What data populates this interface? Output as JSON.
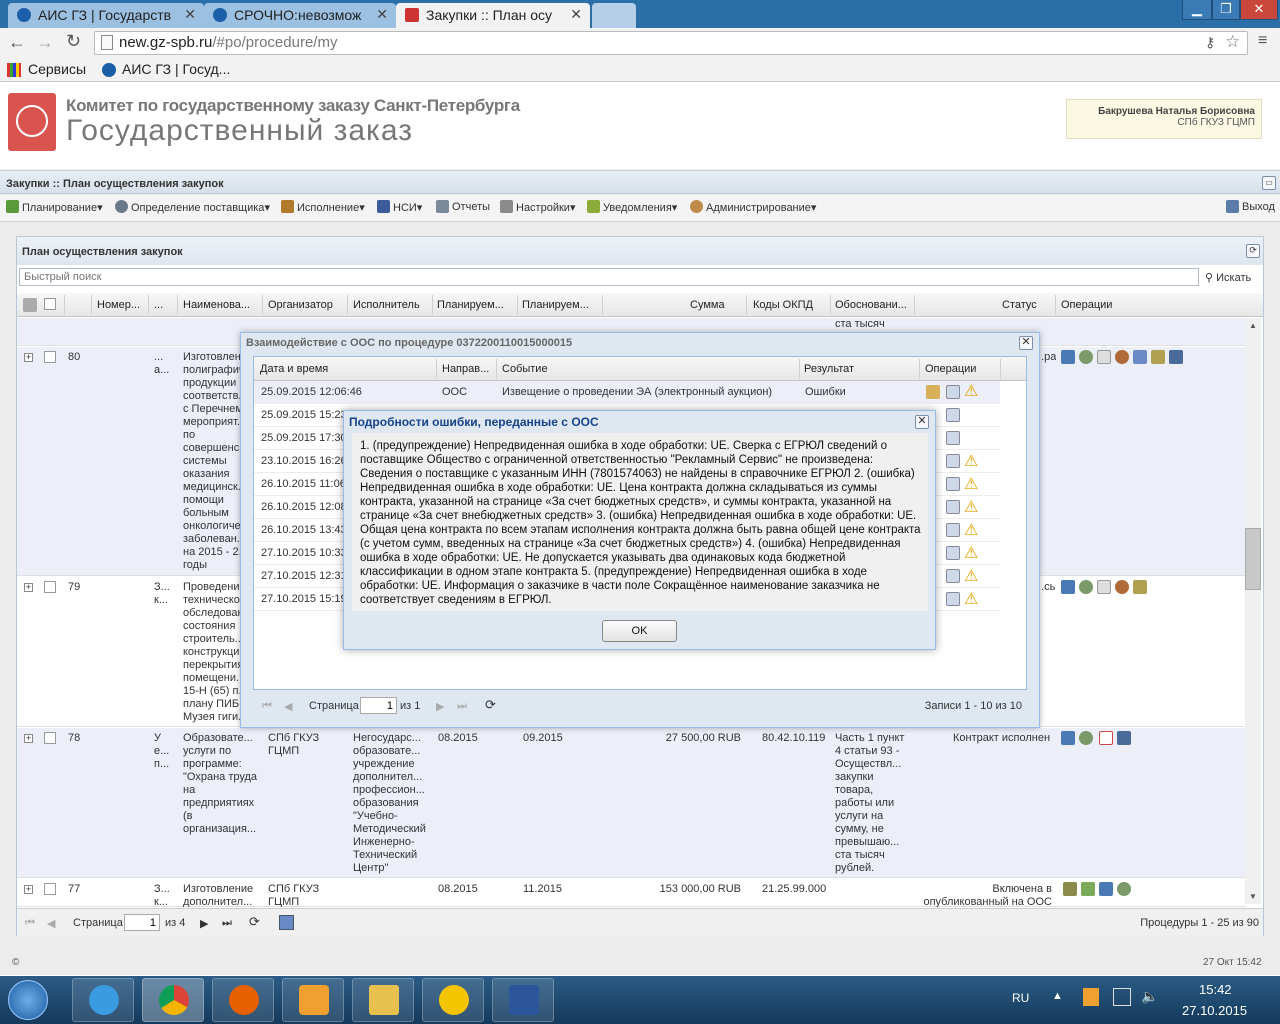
{
  "browser": {
    "tabs": [
      {
        "label": "АИС ГЗ | Государств",
        "active": false
      },
      {
        "label": "СРОЧНО:невозмож",
        "active": false
      },
      {
        "label": "Закупки :: План осу",
        "active": true
      }
    ],
    "url_host": "new.gz-spb.ru",
    "url_path": "/#po/procedure/my",
    "bookmarks": [
      {
        "label": "Сервисы"
      },
      {
        "label": "АИС ГЗ | Госуд..."
      }
    ]
  },
  "header": {
    "org_line1": "Комитет по государственному заказу Санкт-Петербурга",
    "org_line2": "Государственный заказ",
    "user_name": "Бакрушева Наталья Борисовна",
    "user_org": "СПб ГКУЗ ГЦМП"
  },
  "main_panel_title": "Закупки :: План осуществления закупок",
  "menu": {
    "items": [
      {
        "label": "Планирование",
        "color": "#5b9a3a"
      },
      {
        "label": "Определение поставщика",
        "color": "#6a7a8a"
      },
      {
        "label": "Исполнение",
        "color": "#b07a2a"
      },
      {
        "label": "НСИ",
        "color": "#3b5b9a"
      },
      {
        "label": "Отчеты",
        "color": "#7a8a9a"
      },
      {
        "label": "Настройки",
        "color": "#8a8a8a"
      },
      {
        "label": "Уведомления",
        "color": "#8aaa3a"
      },
      {
        "label": "Администрирование",
        "color": "#c08a4a"
      }
    ],
    "logout": "Выход"
  },
  "grid": {
    "title": "План осуществления закупок",
    "search_placeholder": "Быстрый поиск",
    "search_button": "Искать",
    "columns": [
      "Номер...",
      "...",
      "Наименова...",
      "Организатор",
      "Исполнитель",
      "Планируем...",
      "Планируем...",
      "Сумма",
      "Коды ОКПД",
      "Обосновани...",
      "Статус",
      "Операции"
    ],
    "top_fragment": "ста тысяч",
    "rows": [
      {
        "num": "80",
        "c2": "...\nа...",
        "name": "Изготовлен...\nполиграфич...\nпродукции\nсоответств...\nс Перечнем\nмероприят...\nпо\nсовершенс...\nсистемы\nоказания\nмедицинск...\nпомощи\nбольным\nонкологиче...\nзаболеван...\nна 2015 - 2...\nгоды",
        "org": "",
        "exec": "",
        "plan1": "",
        "plan2": "",
        "sum": "",
        "okpd": "",
        "basis": "",
        "status": "...ра"
      },
      {
        "num": "79",
        "c2": "З...\nк...",
        "name": "Проведени...\nтехническо...\nобследован...\nсостояния\nстроитель...\nконструкци...\nперекрытия\nпомещени...\n15-Н (65) п...\nплану ПИБ\nМузея гиги...",
        "org": "",
        "exec": "",
        "plan1": "",
        "plan2": "",
        "sum": "",
        "okpd": "",
        "basis": "",
        "status": "...сь"
      },
      {
        "num": "78",
        "c2": "У\nе...\nп...",
        "name": "Образовате...\nуслуги по\nпрограмме:\n\"Охрана труда\nна\nпредприятиях\n(в\nорганизация...",
        "org": "СПб ГКУЗ\nГЦМП",
        "exec": "Негосударс...\nобразовате...\nучреждение\nдополнител...\nпрофессион...\nобразования\n\"Учебно-\nМетодический\nИнженерно-\nТехнический\nЦентр\"",
        "plan1": "08.2015",
        "plan2": "09.2015",
        "sum": "27 500,00 RUB",
        "okpd": "80.42.10.119",
        "basis": "Часть 1 пункт\n4 статьи 93 -\nОсуществл...\nзакупки\nтовара,\nработы или\nуслуги на\nсумму, не\nпревышаю...\nста тысяч\nрублей.",
        "status": "Контракт исполнен"
      },
      {
        "num": "77",
        "c2": "З...\nк...",
        "name": "Изготовление\nдополнител...",
        "org": "СПб ГКУЗ\nГЦМП",
        "exec": "",
        "plan1": "08.2015",
        "plan2": "11.2015",
        "sum": "153 000,00 RUB",
        "okpd": "21.25.99.000",
        "basis": "",
        "status": "Включена в\nопубликованный на ООС"
      }
    ],
    "pager": {
      "page_label": "Страница",
      "page": "1",
      "of": "из 4",
      "summary": "Процедуры 1 - 25 из 90"
    }
  },
  "dialog_ooc": {
    "title": "Взаимодействие с ООС по процедуре 0372200110015000015",
    "columns": [
      "Дата и время",
      "Направ...",
      "Событие",
      "Результат",
      "Операции"
    ],
    "rows": [
      {
        "dt": "25.09.2015 12:06:46",
        "dir": "ООС",
        "event": "Извещение о проведении ЭА (электронный аукцион)",
        "result": "Ошибки"
      },
      {
        "dt": "25.09.2015 15:23",
        "dir": "",
        "event": "",
        "result": ""
      },
      {
        "dt": "25.09.2015 17:30",
        "dir": "",
        "event": "",
        "result": ""
      },
      {
        "dt": "23.10.2015 16:26",
        "dir": "",
        "event": "",
        "result": ""
      },
      {
        "dt": "26.10.2015 11:06",
        "dir": "",
        "event": "",
        "result": ""
      },
      {
        "dt": "26.10.2015 12:08",
        "dir": "",
        "event": "",
        "result": ""
      },
      {
        "dt": "26.10.2015 13:43",
        "dir": "",
        "event": "",
        "result": ""
      },
      {
        "dt": "27.10.2015 10:33",
        "dir": "",
        "event": "",
        "result": ""
      },
      {
        "dt": "27.10.2015 12:31",
        "dir": "",
        "event": "",
        "result": ""
      },
      {
        "dt": "27.10.2015 15:19",
        "dir": "",
        "event": "",
        "result": ""
      }
    ],
    "pager": {
      "page_label": "Страница",
      "page": "1",
      "of": "из 1",
      "summary": "Записи 1 - 10 из 10"
    }
  },
  "dialog_error": {
    "title": "Подробности ошибки, переданные с ООС",
    "body": "1. (предупреждение) Непредвиденная ошибка в ходе обработки: UE. Сверка с ЕГРЮЛ сведений о поставщике Общество с ограниченной ответственностью \"Рекламный Сервис\" не произведена: Сведения о поставщике с указанным ИНН (7801574063) не найдены в справочнике ЕГРЮЛ 2. (ошибка) Непредвиденная ошибка в ходе обработки: UE. Цена контракта должна складываться из суммы контракта, указанной на странице «За счет бюджетных средств», и суммы контракта, указанной на странице «За счет внебюджетных средств» 3. (ошибка) Непредвиденная ошибка в ходе обработки: UE. Общая цена контракта по всем этапам исполнения контракта должна быть равна общей цене контракта (с учетом сумм, введенных на странице «За счет бюджетных средств») 4. (ошибка) Непредвиденная ошибка в ходе обработки: UE. Не допускается указывать два одинаковых кода бюджетной классификации в одном этапе контракта 5. (предупреждение) Непредвиденная ошибка в ходе обработки: UE. Информация о заказчике в части поле Сокращённое наименование заказчика не соответствует сведениям в ЕГРЮЛ.",
    "ok_label": "OK"
  },
  "footer": {
    "copyright": "©",
    "datetime": "27 Окт 15:42"
  },
  "taskbar": {
    "lang": "RU",
    "time": "15:42",
    "date": "27.10.2015"
  }
}
